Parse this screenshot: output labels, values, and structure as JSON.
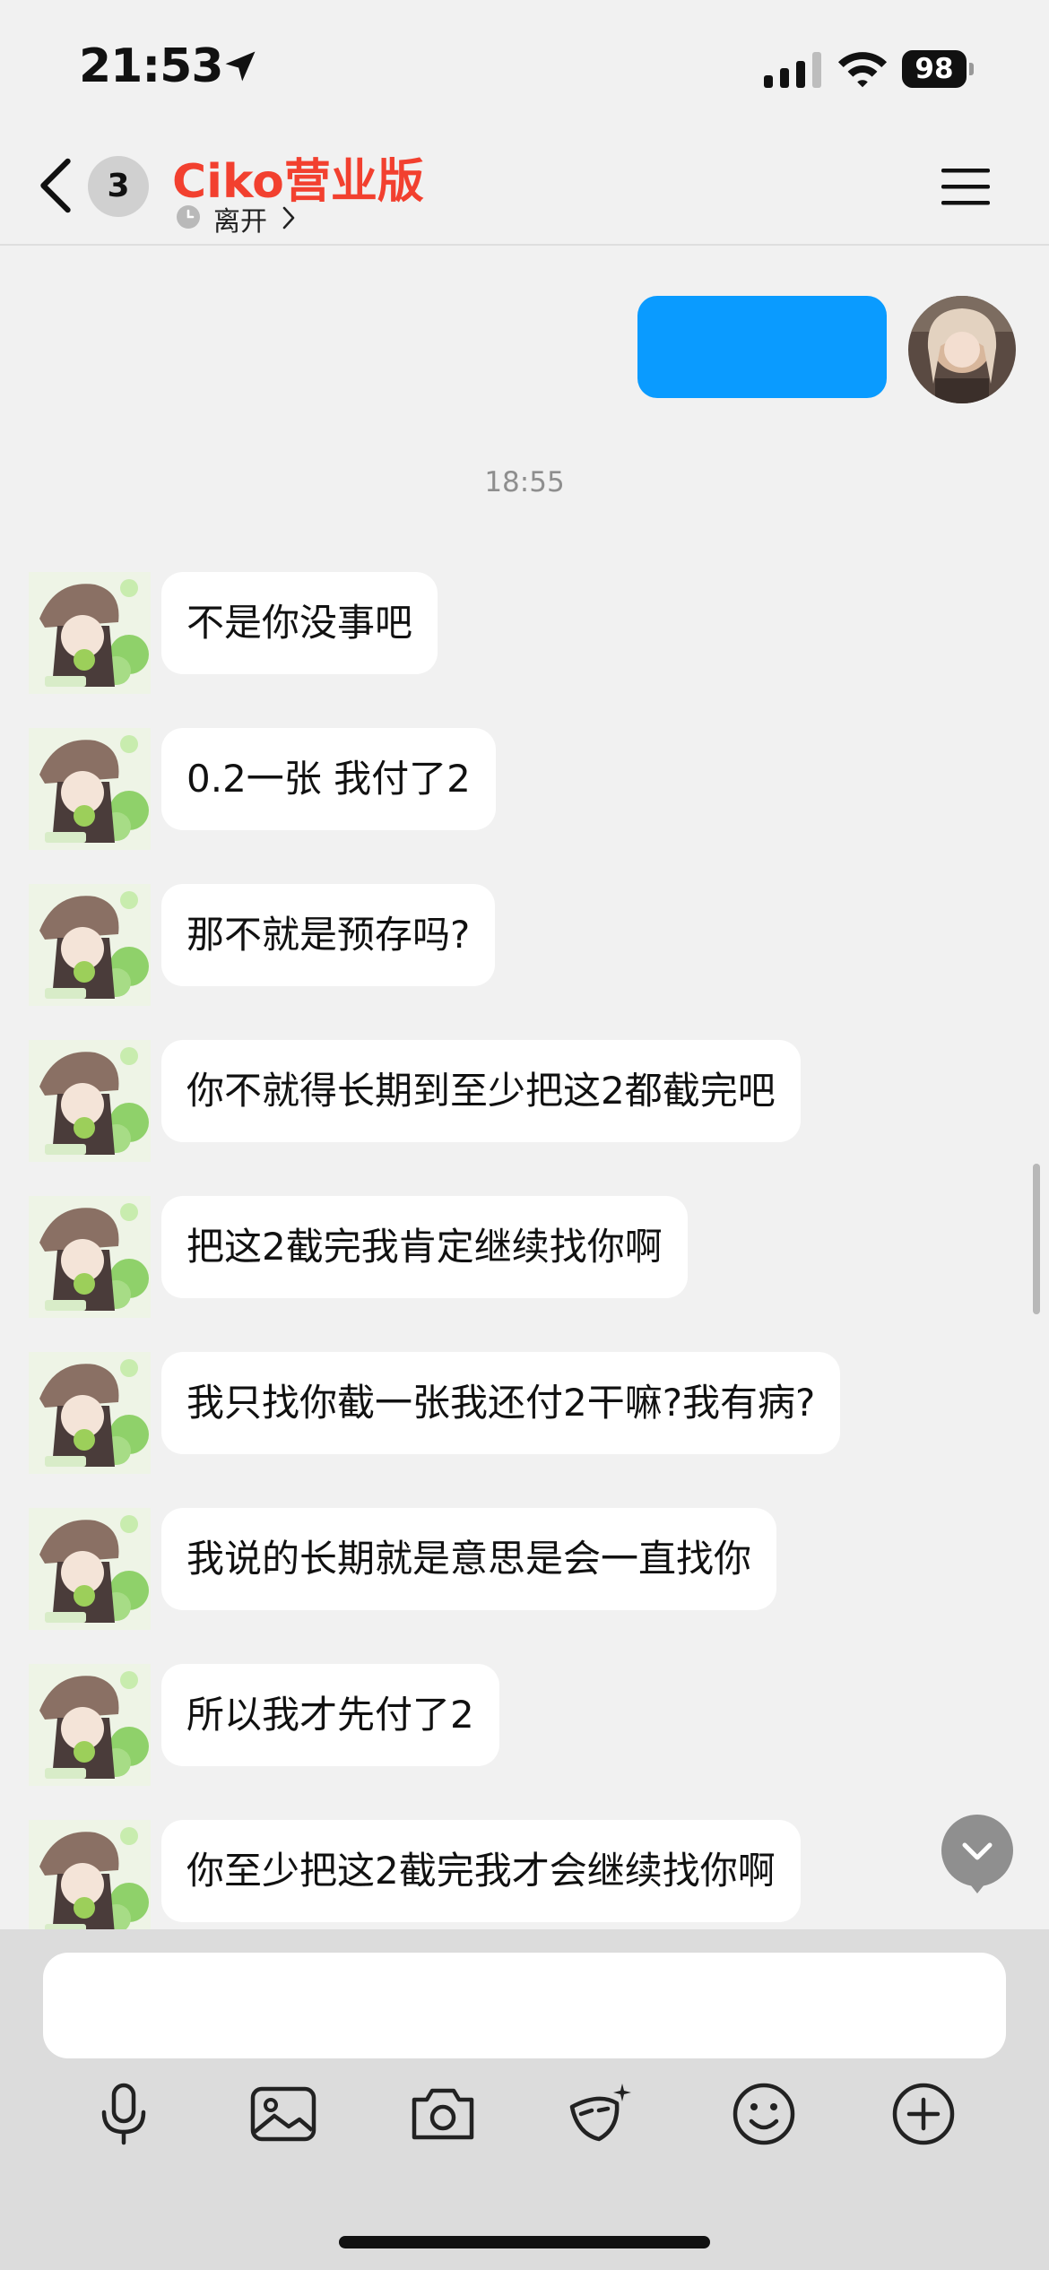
{
  "status_bar": {
    "time": "21:53",
    "battery": "98"
  },
  "header": {
    "unread_count": "3",
    "title": "Ciko营业版",
    "status": "离开"
  },
  "chat": {
    "timestamp": "18:55",
    "messages": [
      "不是你没事吧",
      "0.2一张 我付了2",
      "那不就是预存吗?",
      "你不就得长期到至少把这2都截完吧",
      "把这2截完我肯定继续找你啊",
      "我只找你截一张我还付2干嘛?我有病?",
      "我说的长期就是意思是会一直找你",
      "所以我才先付了2",
      "你至少把这2截完我才会继续找你啊"
    ]
  },
  "colors": {
    "accent_title": "#f2402f",
    "sent_bubble": "#0a9bff"
  },
  "icons": [
    "location-arrow-icon",
    "signal-icon",
    "wifi-icon",
    "back-chevron-icon",
    "clock-icon",
    "chevron-right-icon",
    "menu-icon",
    "scroll-down-icon",
    "microphone-icon",
    "image-icon",
    "camera-icon",
    "mask-effect-icon",
    "emoji-icon",
    "plus-icon"
  ]
}
